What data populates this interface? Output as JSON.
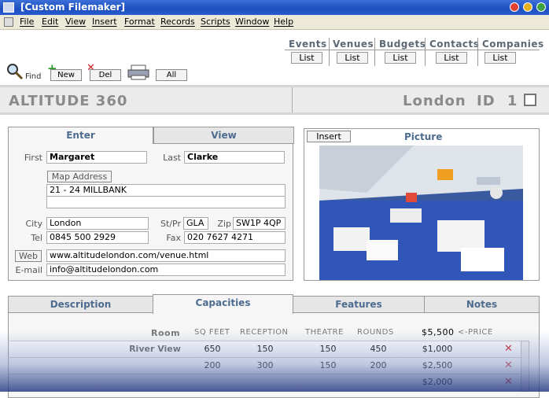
{
  "window": {
    "title": "[Custom Filemaker]"
  },
  "menu": [
    "File",
    "Edit",
    "View",
    "Insert",
    "Format",
    "Records",
    "Scripts",
    "Window",
    "Help"
  ],
  "toolbar": {
    "find": "Find",
    "new": "New",
    "del": "Del",
    "all": "All"
  },
  "nav": {
    "list_label": "List",
    "tabs": [
      "Events",
      "Venues",
      "Budgets",
      "Contacts",
      "Companies"
    ]
  },
  "header": {
    "venue": "ALTITUDE 360",
    "location": "London",
    "id_label": "ID",
    "id_value": "1"
  },
  "form": {
    "tabs": {
      "enter": "Enter",
      "view": "View"
    },
    "first_label": "First",
    "first": "Margaret",
    "last_label": "Last",
    "last": "Clarke",
    "map_address": "Map Address",
    "address": "21 - 24 MILLBANK",
    "address2": "",
    "city_label": "City",
    "city": "London",
    "stpr_label": "St/Pr",
    "stpr": "GLA",
    "zip_label": "Zip",
    "zip": "SW1P 4QP",
    "tel_label": "Tel",
    "tel": "0845 500 2929",
    "fax_label": "Fax",
    "fax": "020 7627 4271",
    "web_label": "Web",
    "web": "www.altitudelondon.com/venue.html",
    "email_label": "E-mail",
    "email": "info@altitudelondon.com"
  },
  "picture": {
    "insert": "Insert",
    "title": "Picture"
  },
  "bottom_tabs": [
    "Description",
    "Capacities",
    "Features",
    "Notes"
  ],
  "capacities": {
    "headers": {
      "room": "Room",
      "sqfeet": "SQ FEET",
      "reception": "RECEPTION",
      "theatre": "THEATRE",
      "rounds": "ROUNDS"
    },
    "price_header": "$5,500",
    "price_note": "<-PRICE",
    "rows": [
      {
        "room": "River View",
        "sqfeet": "650",
        "reception": "150",
        "theatre": "150",
        "rounds": "450",
        "price": "$1,000"
      },
      {
        "room": "",
        "sqfeet": "200",
        "reception": "300",
        "theatre": "150",
        "rounds": "200",
        "price": "$2,500"
      },
      {
        "room": "",
        "sqfeet": "",
        "reception": "",
        "theatre": "",
        "rounds": "",
        "price": "$2,000"
      }
    ]
  },
  "colors": {
    "titlebar": "#1d4fbf",
    "tab_text": "#4e6c90",
    "delete": "#d02020"
  }
}
